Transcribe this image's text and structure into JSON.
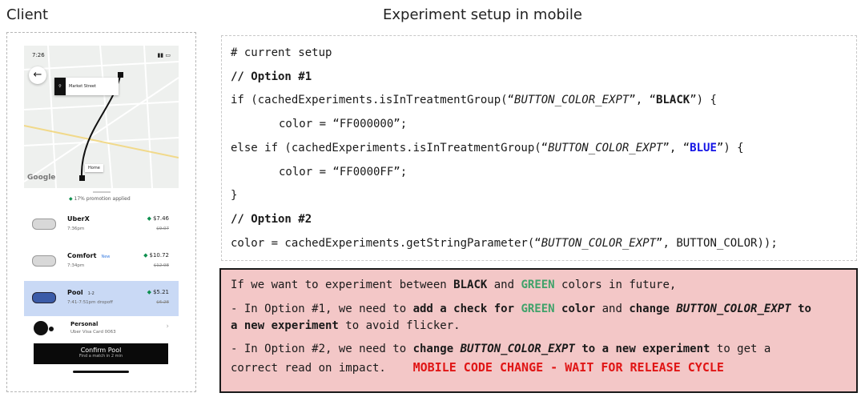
{
  "titles": {
    "client": "Client",
    "setup": "Experiment setup in mobile"
  },
  "phone": {
    "time": "7:26",
    "market_label": "Market Street",
    "home_label": "Home",
    "map_logo": "Google",
    "promo": "17% promotion applied",
    "rides": [
      {
        "name": "UberX",
        "tag": "",
        "sub": "7:36pm",
        "price": "$7.46",
        "old": "$9.07"
      },
      {
        "name": "Comfort",
        "tag": "New",
        "sub": "7:34pm",
        "price": "$10.72",
        "old": "$12.98"
      },
      {
        "name": "Pool",
        "tag": "1-2",
        "sub": "7:41-7:51pm dropoff",
        "price": "$5.21",
        "old": "$6.28"
      }
    ],
    "payment": {
      "name": "Personal",
      "card": "Uber Visa Card 0063"
    },
    "confirm_label": "Confirm Pool",
    "confirm_sub": "Find a match in 2 min"
  },
  "code": {
    "line1": "# current setup",
    "line2": "// Option #1",
    "line3_pre": "if (cachedExperiments.isInTreatmentGroup(“",
    "line3_expt": "BUTTON_COLOR_EXPT",
    "line3_mid": "”, “",
    "line3_val": "BLACK",
    "line3_post": "”) {",
    "line4": "color = “FF000000”;",
    "line5_pre": "else if (cachedExperiments.isInTreatmentGroup(“",
    "line5_expt": "BUTTON_COLOR_EXPT",
    "line5_mid": "”, “",
    "line5_val": "BLUE",
    "line5_post": "”) {",
    "line6": "color = “FF0000FF”;",
    "line7": "}",
    "line8": "// Option #2",
    "line9_pre": "color = cachedExperiments.getStringParameter(“",
    "line9_expt": "BUTTON_COLOR_EXPT",
    "line9_post": "”, BUTTON_COLOR));"
  },
  "note": {
    "l1_a": "If we want to experiment between ",
    "l1_b": "BLACK",
    "l1_c": " and ",
    "l1_d": "GREEN",
    "l1_e": " colors in future,",
    "l2_a": "- In Option #1, we need to ",
    "l2_b": "add a check for ",
    "l2_c": "GREEN",
    "l2_d": " color",
    "l2_e": " and ",
    "l2_f": "change ",
    "l2_g": "BUTTON_COLOR_EXPT",
    "l2_h": " to",
    "l3_a": "a new experiment",
    "l3_b": " to avoid flicker.",
    "l4_a": "- In Option #2, we need to ",
    "l4_b": "change ",
    "l4_c": "BUTTON_COLOR_EXPT",
    "l4_d": " to a new experiment",
    "l4_e": " to get a",
    "l5_a": "correct read on impact.",
    "l5_warn": "MOBILE CODE CHANGE - WAIT FOR RELEASE CYCLE"
  },
  "colors": {
    "note_bg": "#f3c7c7",
    "green": "#3fa26a",
    "blue": "#1414e6",
    "warning": "#e01515",
    "selected_ride": "#c9d9f5"
  }
}
